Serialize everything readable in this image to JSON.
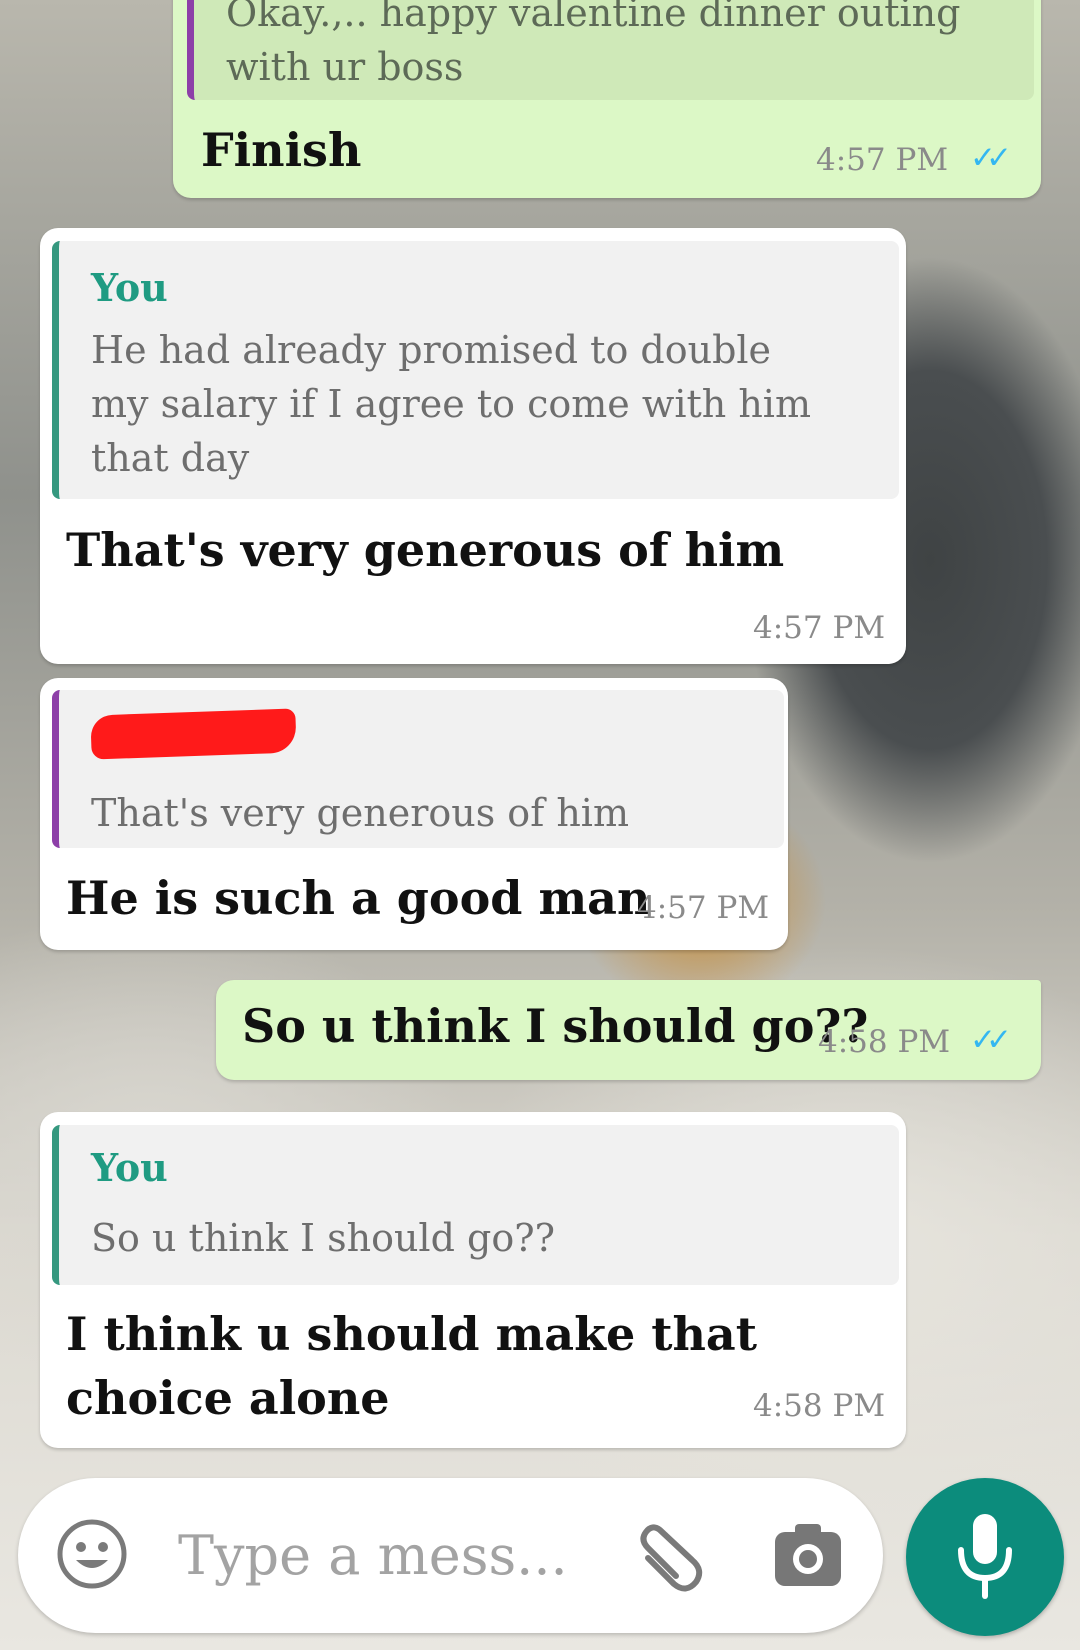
{
  "messages": [
    {
      "direction": "outgoing",
      "quote_text": "Okay.,.. happy valentine dinner outing with ur boss",
      "text": "Finish",
      "time": "4:57 PM",
      "status_icon": "double-check-read"
    },
    {
      "direction": "incoming",
      "quote_author": "You",
      "quote_text": "He had already promised to double my salary if I agree to come with him that day",
      "text": "That's very generous of him",
      "time": "4:57 PM"
    },
    {
      "direction": "incoming",
      "quote_author_redacted": true,
      "quote_text": "That's very generous of him",
      "text": "He is such a good man",
      "time": "4:57 PM"
    },
    {
      "direction": "outgoing",
      "text": "So u think I should go??",
      "time": "4:58 PM",
      "status_icon": "double-check-read"
    },
    {
      "direction": "incoming",
      "quote_author": "You",
      "quote_text": "So u think I should go??",
      "text": "I think u should make that choice alone",
      "time": "4:58 PM"
    }
  ],
  "input_bar": {
    "placeholder": "Type a mess...",
    "left_icon": "emoji-icon",
    "attach_icon": "paperclip-icon",
    "camera_icon": "camera-icon",
    "send_icon": "microphone-icon"
  },
  "colors": {
    "outgoing_bubble": "#dcf8c6",
    "incoming_bubble": "#ffffff",
    "accent": "#0c8c7c",
    "quote_author": "#1f9b82",
    "read_ticks": "#34b7f1"
  }
}
